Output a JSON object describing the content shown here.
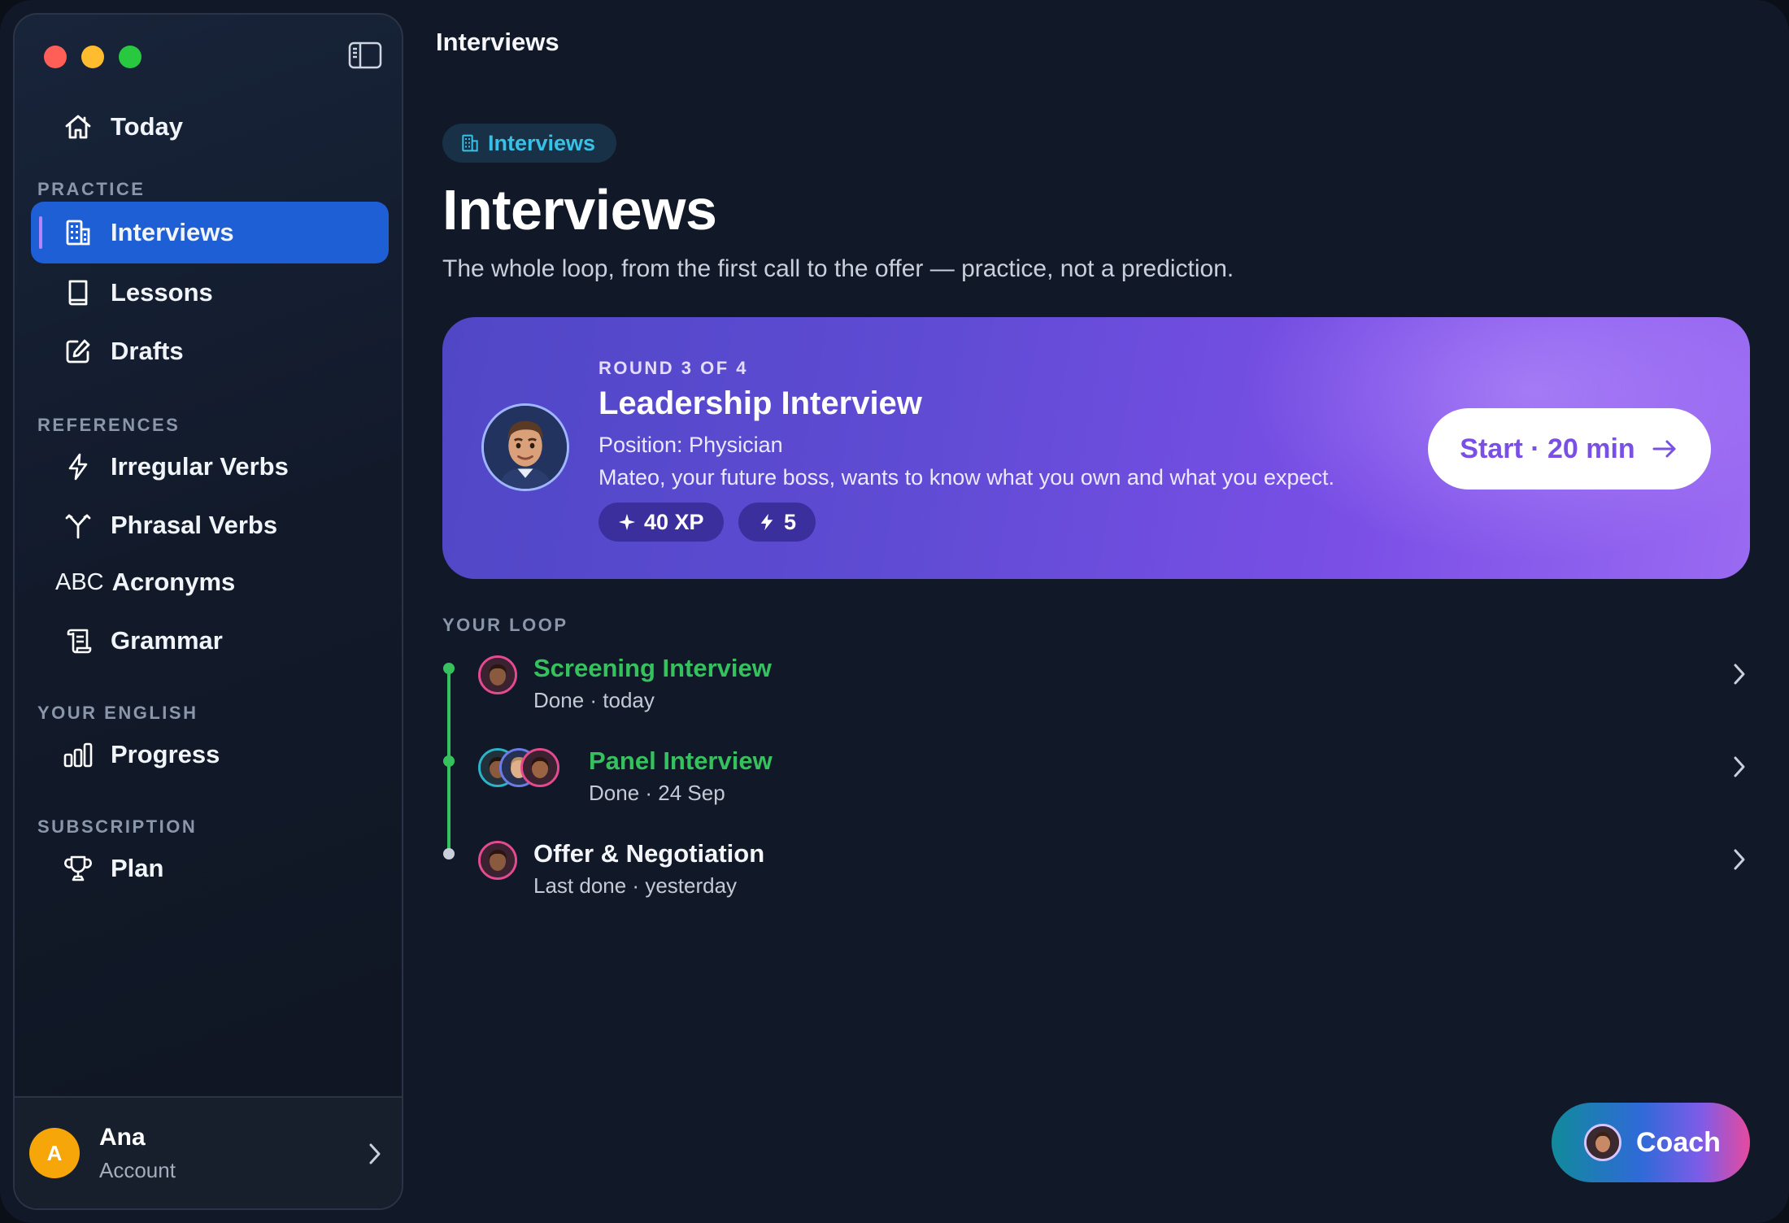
{
  "window": {
    "title": "Interviews"
  },
  "sidebar": {
    "today": {
      "label": "Today",
      "icon": "home-icon"
    },
    "sections": {
      "practice": "PRACTICE",
      "references": "REFERENCES",
      "your_english": "YOUR ENGLISH",
      "subscription": "SUBSCRIPTION"
    },
    "practice_items": [
      {
        "label": "Interviews",
        "icon": "building-icon",
        "active": true
      },
      {
        "label": "Lessons",
        "icon": "book-icon"
      },
      {
        "label": "Drafts",
        "icon": "edit-icon"
      }
    ],
    "reference_items": [
      {
        "label": "Irregular Verbs",
        "icon": "bolt-icon"
      },
      {
        "label": "Phrasal Verbs",
        "icon": "fork-icon"
      },
      {
        "label": "Acronyms",
        "prefix": "ABC",
        "icon": "abc-icon"
      },
      {
        "label": "Grammar",
        "icon": "scroll-icon"
      }
    ],
    "english_items": [
      {
        "label": "Progress",
        "icon": "bar-chart-icon"
      }
    ],
    "subscription_items": [
      {
        "label": "Plan",
        "icon": "trophy-icon"
      }
    ],
    "account": {
      "initial": "A",
      "name": "Ana",
      "subtitle": "Account",
      "color": "#f6a609"
    }
  },
  "main": {
    "tag": "Interviews",
    "title": "Interviews",
    "subtitle": "The whole loop, from the first call to the offer — practice, not a prediction.",
    "hero": {
      "round": "ROUND 3 OF 4",
      "title": "Leadership Interview",
      "position": "Position: Physician",
      "description": "Mateo, your future boss, wants to know what you own and what you expect.",
      "xp_chip": "40 XP",
      "energy_chip": "5",
      "start_button": "Start · 20 min"
    },
    "loop_label": "YOUR LOOP",
    "loop": [
      {
        "title": "Screening Interview",
        "status": "Done · today",
        "done": true
      },
      {
        "title": "Panel Interview",
        "status": "Done · 24 Sep",
        "done": true
      },
      {
        "title": "Offer & Negotiation",
        "status": "Last done · yesterday",
        "done": false
      }
    ],
    "coach_button": "Coach"
  },
  "colors": {
    "accent": "#1f5fd6",
    "success": "#35c25e",
    "hero_start": "#5047c6",
    "hero_end": "#9a6af2",
    "tag_text": "#38c1e6"
  }
}
